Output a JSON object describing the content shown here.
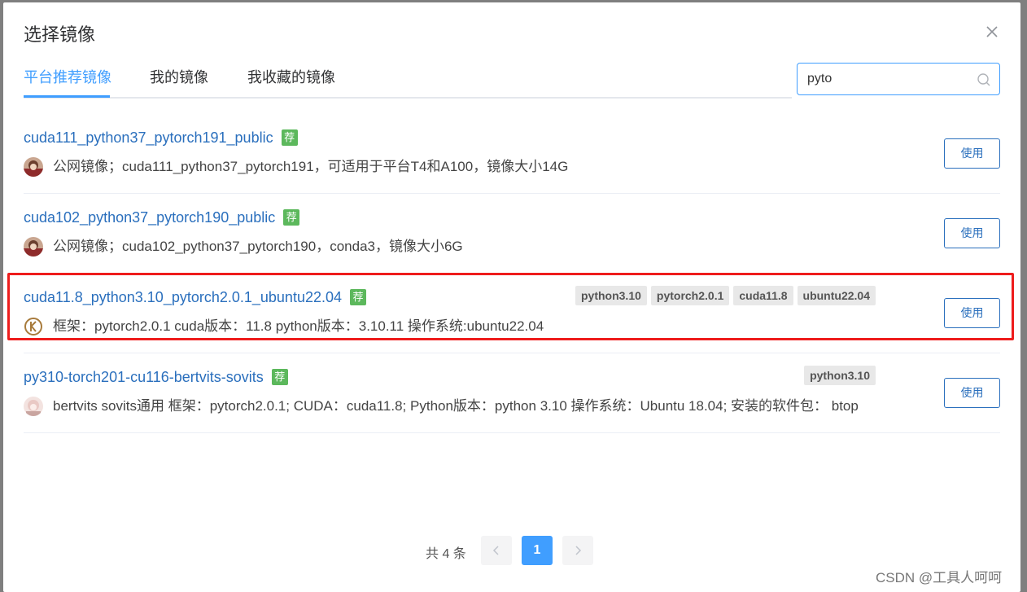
{
  "dialog": {
    "title": "选择镜像",
    "close_icon": "close-icon"
  },
  "tabs": [
    {
      "label": "平台推荐镜像",
      "active": true
    },
    {
      "label": "我的镜像",
      "active": false
    },
    {
      "label": "我收藏的镜像",
      "active": false
    }
  ],
  "search": {
    "value": "pyto",
    "icon": "search-icon"
  },
  "images": [
    {
      "name": "cuda111_python37_pytorch191_public",
      "badge": "荐",
      "description": "公网镜像；cuda111_python37_pytorch191，可适用于平台T4和A100，镜像大小14G",
      "tags": [],
      "use_label": "使用"
    },
    {
      "name": "cuda102_python37_pytorch190_public",
      "badge": "荐",
      "description": "公网镜像；cuda102_python37_pytorch190，conda3，镜像大小6G",
      "tags": [],
      "use_label": "使用"
    },
    {
      "name": "cuda11.8_python3.10_pytorch2.0.1_ubuntu22.04",
      "badge": "荐",
      "description": "框架：pytorch2.0.1 cuda版本：11.8 python版本：3.10.11 操作系统:ubuntu22.04",
      "tags": [
        "python3.10",
        "pytorch2.0.1",
        "cuda11.8",
        "ubuntu22.04"
      ],
      "use_label": "使用"
    },
    {
      "name": "py310-torch201-cu116-bertvits-sovits",
      "badge": "荐",
      "description": "bertvits sovits通用 框架：pytorch2.0.1; CUDA：cuda11.8; Python版本：python 3.10 操作系统：Ubuntu 18.04; 安装的软件包： btop",
      "tags": [
        "python3.10"
      ],
      "use_label": "使用"
    }
  ],
  "pagination": {
    "total_text": "共 4 条",
    "current_page": "1",
    "prev_icon": "chevron-left-icon",
    "next_icon": "chevron-right-icon"
  },
  "watermark": "CSDN @工具人呵呵",
  "colors": {
    "accent": "#409eff",
    "link": "#2a6fbd",
    "badge": "#5cb85c",
    "highlight_border": "#ee1c1c"
  }
}
